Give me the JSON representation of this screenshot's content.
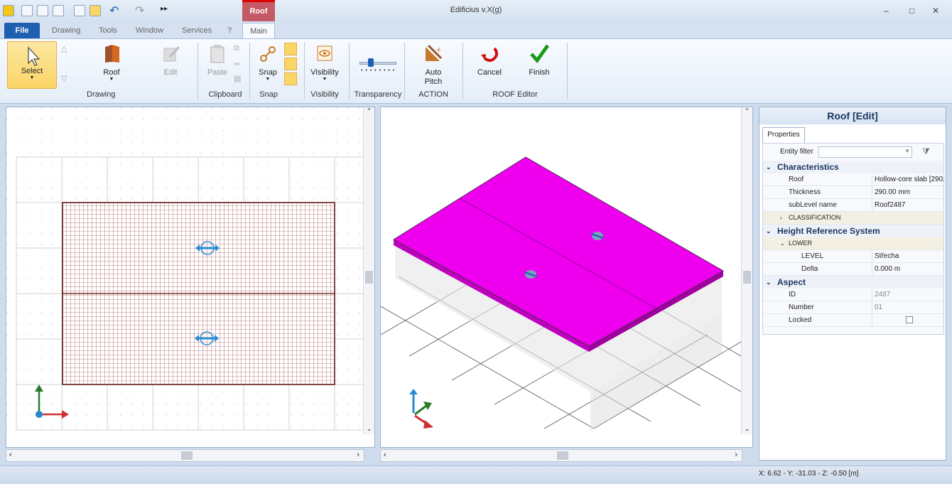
{
  "window": {
    "title": "Edificius v.X(g)",
    "contextual_tab": "Roof",
    "min": "–",
    "max": "□",
    "close": "✕"
  },
  "tabs": {
    "file": "File",
    "items": [
      "Drawing",
      "Tools",
      "Window",
      "Services",
      "?"
    ],
    "active": "Main"
  },
  "ribbon": {
    "select": "Select",
    "roof": "Roof",
    "edit": "Edit",
    "paste": "Paste",
    "snap": "Snap",
    "visibility": "Visibility",
    "auto_pitch_1": "Auto",
    "auto_pitch_2": "Pitch",
    "cancel": "Cancel",
    "finish": "Finish",
    "groups": {
      "drawing": "Drawing",
      "clipboard": "Clipboard",
      "snap": "Snap",
      "visibility": "Visibility",
      "transparency": "Transparency",
      "action": "ACTION",
      "roof_editor": "ROOF Editor"
    }
  },
  "panel": {
    "title": "Roof [Edit]",
    "tab": "Properties",
    "entity_filter": "Entity filter",
    "sections": {
      "characteristics": "Characteristics",
      "height": "Height Reference System",
      "aspect": "Aspect"
    },
    "rows": {
      "roof": {
        "name": "Roof",
        "value": "Hollow-core slab [290."
      },
      "thickness": {
        "name": "Thickness",
        "value": "290.00 mm"
      },
      "sublevel": {
        "name": "subLevel name",
        "value": "Roof2487"
      },
      "classification": "CLASSIFICATION",
      "lower": "LOWER",
      "level": {
        "name": "LEVEL",
        "value": "Střecha"
      },
      "delta": {
        "name": "Delta",
        "value": "0.000 m"
      },
      "id": {
        "name": "ID",
        "value": "2487"
      },
      "number": {
        "name": "Number",
        "value": "01"
      },
      "locked": {
        "name": "Locked"
      }
    }
  },
  "status": {
    "coords": "X: 6.62 - Y: -31.03 - Z: -0.50 [m]"
  },
  "colors": {
    "roof": "#ee00ee",
    "grid_hatch": "#8b1a1a"
  }
}
